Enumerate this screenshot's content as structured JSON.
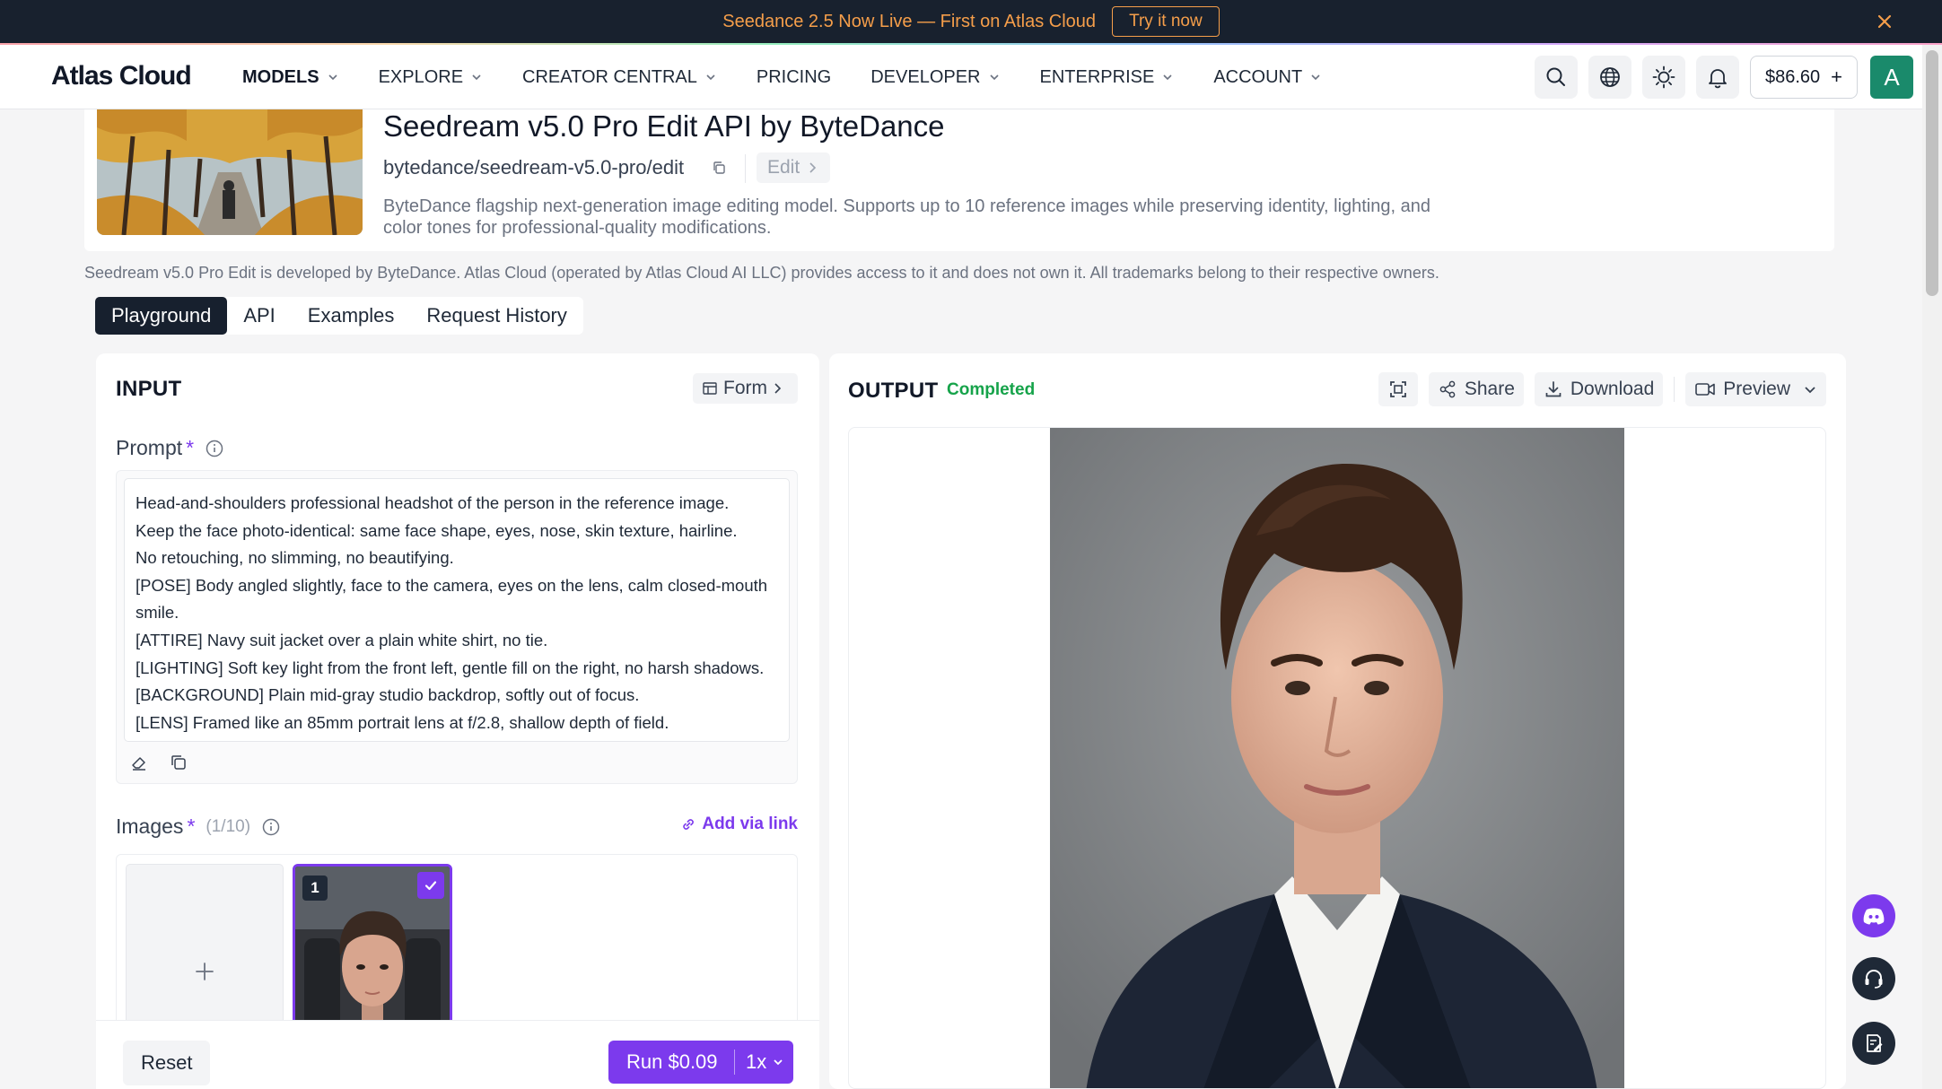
{
  "announcement": {
    "text": "Seedance 2.5 Now Live — First on Atlas Cloud",
    "cta": "Try it now",
    "accent": "#f59e4a"
  },
  "nav": {
    "logo": "Atlas Cloud",
    "items": [
      {
        "label": "MODELS",
        "dropdown": true
      },
      {
        "label": "EXPLORE",
        "dropdown": true
      },
      {
        "label": "CREATOR CENTRAL",
        "dropdown": true
      },
      {
        "label": "PRICING",
        "dropdown": false
      },
      {
        "label": "DEVELOPER",
        "dropdown": true
      },
      {
        "label": "ENTERPRISE",
        "dropdown": true
      },
      {
        "label": "ACCOUNT",
        "dropdown": true
      }
    ],
    "balance": "$86.60",
    "balance_plus": "+",
    "avatar_initial": "A",
    "avatar_color": "#1a8a6b"
  },
  "model": {
    "title": "Seedream v5.0 Pro Edit API by ByteDance",
    "slug": "bytedance/seedream-v5.0-pro/edit",
    "edit_label": "Edit",
    "description": "ByteDance flagship next-generation image editing model. Supports up to 10 reference images while preserving identity, lighting, and color tones for professional-quality modifications."
  },
  "disclaimer": "Seedream v5.0 Pro Edit is developed by ByteDance. Atlas Cloud (operated by Atlas Cloud AI LLC) provides access to it and does not own it. All trademarks belong to their respective owners.",
  "tabs": [
    "Playground",
    "API",
    "Examples",
    "Request History"
  ],
  "input": {
    "title": "INPUT",
    "form_label": "Form",
    "prompt_label": "Prompt",
    "required_mark": "*",
    "prompt_lines": [
      "Head-and-shoulders professional headshot of the person in the reference image.",
      "Keep the face photo-identical: same face shape, eyes, nose, skin texture, hairline.",
      "No retouching, no slimming, no beautifying.",
      "[POSE] Body angled slightly, face to the camera, eyes on the lens, calm closed-mouth",
      "smile.",
      "[ATTIRE] Navy suit jacket over a plain white shirt, no tie.",
      "[LIGHTING] Soft key light from the front left, gentle fill on the right, no harsh shadows.",
      "[BACKGROUND] Plain mid-gray studio backdrop, softly out of focus.",
      "[LENS] Framed like an 85mm portrait lens at f/2.8, shallow depth of field."
    ],
    "images_label": "Images",
    "images_count": "(1/10)",
    "add_link": "Add via link",
    "image_index": "1",
    "reset": "Reset",
    "run": "Run $0.09",
    "multiplier": "1x",
    "accent": "#7c3aed"
  },
  "output": {
    "title": "OUTPUT",
    "status": "Completed",
    "share": "Share",
    "download": "Download",
    "preview": "Preview",
    "status_color": "#16a34a"
  }
}
